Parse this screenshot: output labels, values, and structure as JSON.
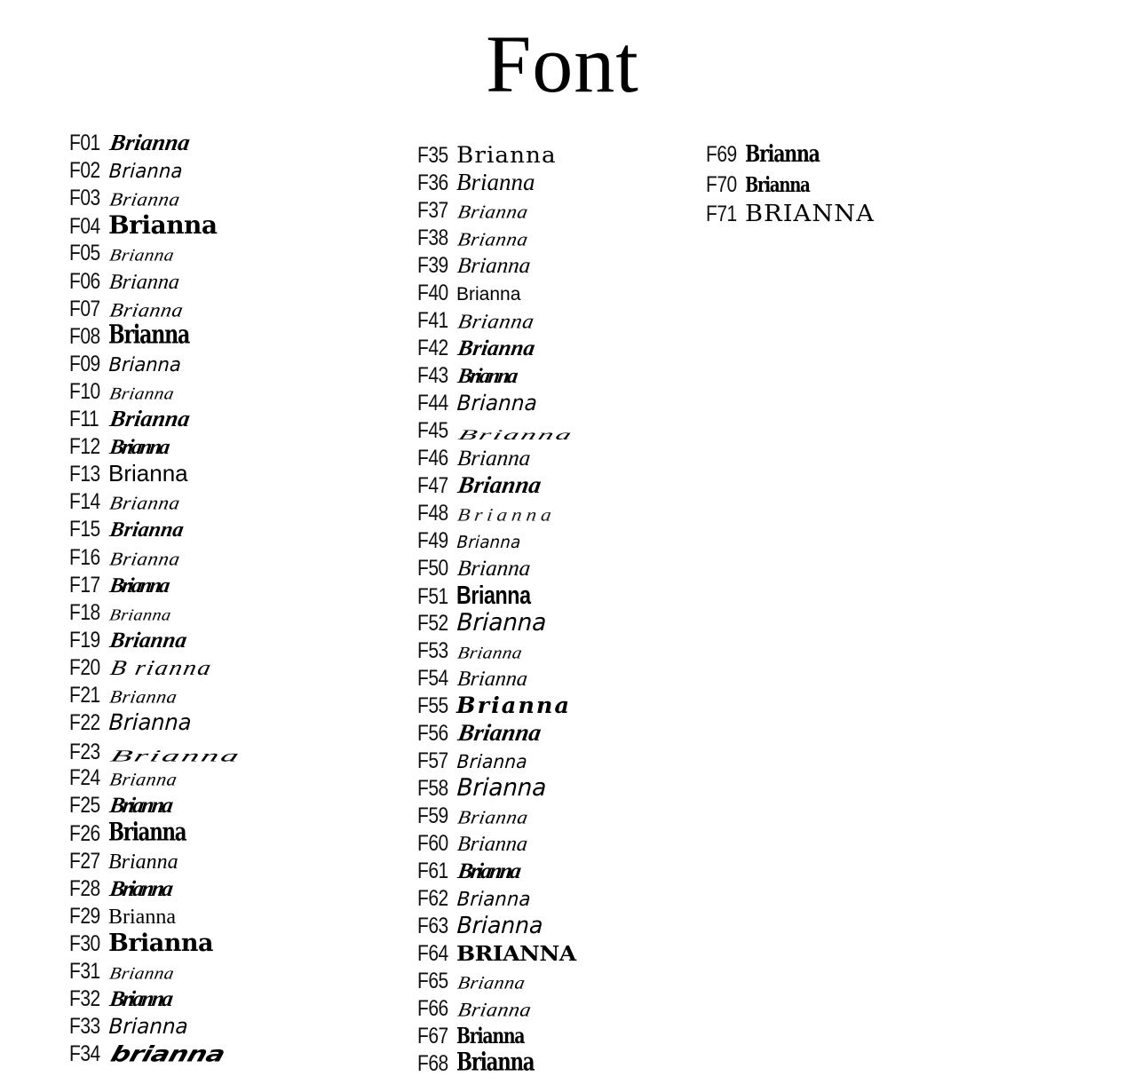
{
  "page": {
    "title": "Font",
    "background_color": "#ffffff",
    "text_color": "#000000",
    "sample_word": "Brianna",
    "total_samples": 71
  },
  "columns": [
    {
      "index": 0,
      "rows": [
        {
          "code": "F01",
          "sample": "Brianna",
          "style": "v-script-bold",
          "size": 26,
          "style_note": "bold brush script"
        },
        {
          "code": "F02",
          "sample": "Brianna",
          "style": "v-hand-light",
          "size": 22,
          "style_note": "light handwriting with flourish"
        },
        {
          "code": "F03",
          "sample": "Brianna",
          "style": "v-script-thin",
          "size": 23,
          "style_note": "thin formal script"
        },
        {
          "code": "F04",
          "sample": "Brianna",
          "style": "v-slab-bold",
          "size": 28,
          "style_note": "heavy slab serif"
        },
        {
          "code": "F05",
          "sample": "Brianna",
          "style": "v-script-thin",
          "size": 21,
          "style_note": "delicate copperplate"
        },
        {
          "code": "F06",
          "sample": "Brianna",
          "style": "v-script",
          "size": 24,
          "style_note": "casual script"
        },
        {
          "code": "F07",
          "sample": "Brianna",
          "style": "v-script-thin",
          "size": 24,
          "style_note": "flowing calligraphy"
        },
        {
          "code": "F08",
          "sample": "Brianna",
          "style": "v-blackletter",
          "size": 27,
          "style_note": "blackletter / gothic"
        },
        {
          "code": "F09",
          "sample": "Brianna",
          "style": "v-hand",
          "size": 21,
          "style_note": "small caps handwriting"
        },
        {
          "code": "F10",
          "sample": "Brianna",
          "style": "v-script-thin",
          "size": 21,
          "style_note": "fine engraved script"
        },
        {
          "code": "F11",
          "sample": "Brianna",
          "style": "v-script-bold",
          "size": 26,
          "style_note": "bold italic script"
        },
        {
          "code": "F12",
          "sample": "Brianna",
          "style": "v-tight-bold-script",
          "size": 24,
          "style_note": "condensed bold script"
        },
        {
          "code": "F13",
          "sample": "Brianna",
          "style": "v-sans-plain",
          "size": 26,
          "style_note": "plain sans serif"
        },
        {
          "code": "F14",
          "sample": "Brianna",
          "style": "v-script-thin",
          "size": 23,
          "style_note": "open roundhand"
        },
        {
          "code": "F15",
          "sample": "Brianna",
          "style": "v-script-bold",
          "size": 24,
          "style_note": "bold connected script"
        },
        {
          "code": "F16",
          "sample": "Brianna",
          "style": "v-script-thin",
          "size": 23,
          "style_note": "light italic script"
        },
        {
          "code": "F17",
          "sample": "Brianna",
          "style": "v-tight-bold-script",
          "size": 24,
          "style_note": "tight brush script"
        },
        {
          "code": "F18",
          "sample": "Brianna",
          "style": "v-script-thin",
          "size": 20,
          "style_note": "small fine script"
        },
        {
          "code": "F19",
          "sample": "Brianna",
          "style": "v-script-bold",
          "size": 25,
          "style_note": "bold marker script"
        },
        {
          "code": "F20",
          "sample": "B rianna",
          "style": "v-script-wide",
          "size": 24,
          "style_note": "wide spaced script"
        },
        {
          "code": "F21",
          "sample": "Brianna",
          "style": "v-script-thin",
          "size": 22,
          "style_note": "fine swash script"
        },
        {
          "code": "F22",
          "sample": "Brianna",
          "style": "v-hand",
          "size": 24,
          "style_note": "casual print handwriting"
        },
        {
          "code": "F23",
          "sample": "Brianna",
          "style": "v-signature",
          "size": 30,
          "style_note": "wide thin signature"
        },
        {
          "code": "F24",
          "sample": "Brianna",
          "style": "v-script-thin",
          "size": 22,
          "style_note": "light outline script"
        },
        {
          "code": "F25",
          "sample": "Brianna",
          "style": "v-tight-bold-script",
          "size": 25,
          "style_note": "brush script with tail"
        },
        {
          "code": "F26",
          "sample": "Brianna",
          "style": "v-blackletter",
          "size": 26,
          "style_note": "old english blackletter"
        },
        {
          "code": "F27",
          "sample": "Brianna",
          "style": "v-serif-italic",
          "size": 24,
          "style_note": "serif italic"
        },
        {
          "code": "F28",
          "sample": "Brianna",
          "style": "v-tight-bold-script",
          "size": 25,
          "style_note": "overlapping bold script"
        },
        {
          "code": "F29",
          "sample": "Brianna",
          "style": "s-serif",
          "size": 24,
          "style_note": "classic serif"
        },
        {
          "code": "F30",
          "sample": "Brianna",
          "style": "v-slab-bold",
          "size": 27,
          "style_note": "bold rounded sans"
        },
        {
          "code": "F31",
          "sample": "Brianna",
          "style": "v-script-thin",
          "size": 21,
          "style_note": "light italic script"
        },
        {
          "code": "F32",
          "sample": "Brianna",
          "style": "v-tight-bold-script",
          "size": 25,
          "style_note": "bold handbrush"
        },
        {
          "code": "F33",
          "sample": "Brianna",
          "style": "v-hand",
          "size": 23,
          "style_note": "quirky decorative serif"
        },
        {
          "code": "F34",
          "sample": "brianna",
          "style": "v-racing",
          "size": 27,
          "style_note": "heavy italic racing lowercase"
        }
      ]
    },
    {
      "index": 1,
      "rows": [
        {
          "code": "F35",
          "sample": "Brianna",
          "style": "v-wide-serif-caps",
          "size": 25,
          "style_note": "high contrast didone"
        },
        {
          "code": "F36",
          "sample": "Brianna",
          "style": "v-serif-italic",
          "size": 27,
          "style_note": "bold didone italic"
        },
        {
          "code": "F37",
          "sample": "Brianna",
          "style": "v-script-thin",
          "size": 23,
          "style_note": "fine pointed script"
        },
        {
          "code": "F38",
          "sample": "Brianna",
          "style": "v-script-thin",
          "size": 23,
          "style_note": "thin swash signature"
        },
        {
          "code": "F39",
          "sample": "Brianna",
          "style": "v-script",
          "size": 25,
          "style_note": "rounded script"
        },
        {
          "code": "F40",
          "sample": "Brianna",
          "style": "v-sans-plain",
          "size": 21,
          "style_note": "small condensed sans"
        },
        {
          "code": "F41",
          "sample": "Brianna",
          "style": "v-script-thin",
          "size": 25,
          "style_note": "elegant calligraphy"
        },
        {
          "code": "F42",
          "sample": "Brianna",
          "style": "v-script-bold",
          "size": 25,
          "style_note": "bold brush script"
        },
        {
          "code": "F43",
          "sample": "Brianna",
          "style": "v-tight-bold-script",
          "size": 24,
          "style_note": "bold marker hand"
        },
        {
          "code": "F44",
          "sample": "Brianna",
          "style": "v-hand-light",
          "size": 24,
          "style_note": "light hand print"
        },
        {
          "code": "F45",
          "sample": "Brianna",
          "style": "v-signature",
          "size": 26,
          "style_note": "abstract minimal signature"
        },
        {
          "code": "F46",
          "sample": "Brianna",
          "style": "v-script",
          "size": 25,
          "style_note": "classic script"
        },
        {
          "code": "F47",
          "sample": "Brianna",
          "style": "v-script-bold",
          "size": 27,
          "style_note": "heavy brush script"
        },
        {
          "code": "F48",
          "sample": "Brianna",
          "style": "v-thin-tracked",
          "size": 23,
          "style_note": "hairline tracked script"
        },
        {
          "code": "F49",
          "sample": "Brianna",
          "style": "v-hand-light",
          "size": 19,
          "style_note": "small handwriting"
        },
        {
          "code": "F50",
          "sample": "Brianna",
          "style": "v-script",
          "size": 25,
          "style_note": "sloped script"
        },
        {
          "code": "F51",
          "sample": "Brianna",
          "style": "v-sans-bold-cond",
          "size": 29,
          "style_note": "heavy condensed sans"
        },
        {
          "code": "F52",
          "sample": "Brianna",
          "style": "v-hand",
          "size": 26,
          "style_note": "open rounded hand"
        },
        {
          "code": "F53",
          "sample": "Brianna",
          "style": "v-script-thin",
          "size": 21,
          "style_note": "small formal script"
        },
        {
          "code": "F54",
          "sample": "Brianna",
          "style": "v-script",
          "size": 24,
          "style_note": "retro script"
        },
        {
          "code": "F55",
          "sample": "Brianna",
          "style": "v-bold-wide-slab",
          "size": 25,
          "style_note": "bold wide slab italic"
        },
        {
          "code": "F56",
          "sample": "Brianna",
          "style": "v-script-bold",
          "size": 27,
          "style_note": "bold flowing script"
        },
        {
          "code": "F57",
          "sample": "Brianna",
          "style": "v-hand-light",
          "size": 21,
          "style_note": "thin signature hand"
        },
        {
          "code": "F58",
          "sample": "Brianna",
          "style": "v-hand",
          "size": 26,
          "style_note": "thin modern hand"
        },
        {
          "code": "F59",
          "sample": "Brianna",
          "style": "v-script-thin",
          "size": 23,
          "style_note": "fine roundhand"
        },
        {
          "code": "F60",
          "sample": "Brianna",
          "style": "v-script",
          "size": 24,
          "style_note": "bouncy script"
        },
        {
          "code": "F61",
          "sample": "Brianna",
          "style": "v-tight-bold-script",
          "size": 25,
          "style_note": "condensed bold script"
        },
        {
          "code": "F62",
          "sample": "Brianna",
          "style": "v-hand-light",
          "size": 22,
          "style_note": "sketchy handwriting"
        },
        {
          "code": "F63",
          "sample": "Brianna",
          "style": "v-hand",
          "size": 25,
          "style_note": "tall thin hand"
        },
        {
          "code": "F64",
          "sample": "BRIANNA",
          "style": "v-tiki-caps",
          "size": 25,
          "style_note": "decorative tiki caps"
        },
        {
          "code": "F65",
          "sample": "Brianna",
          "style": "v-script-thin",
          "size": 22,
          "style_note": "small engraved script"
        },
        {
          "code": "F66",
          "sample": "Brianna",
          "style": "v-script-thin",
          "size": 24,
          "style_note": "formal copperplate"
        },
        {
          "code": "F67",
          "sample": "Brianna",
          "style": "v-blackletter",
          "size": 23,
          "style_note": "gothic serif"
        },
        {
          "code": "F68",
          "sample": "Brianna",
          "style": "v-blackletter",
          "size": 26,
          "style_note": "fantasy gothic"
        }
      ]
    },
    {
      "index": 2,
      "rows": [
        {
          "code": "F69",
          "sample": "Brianna",
          "style": "v-blackletter",
          "size": 25,
          "style_note": "old english blackletter"
        },
        {
          "code": "F70",
          "sample": "Brianna",
          "style": "v-blackletter",
          "size": 22,
          "style_note": "condensed blackletter"
        },
        {
          "code": "F71",
          "sample": "BRIANNA",
          "style": "v-wide-serif-caps",
          "size": 26,
          "style_note": "wide celtic serif caps"
        }
      ]
    }
  ]
}
